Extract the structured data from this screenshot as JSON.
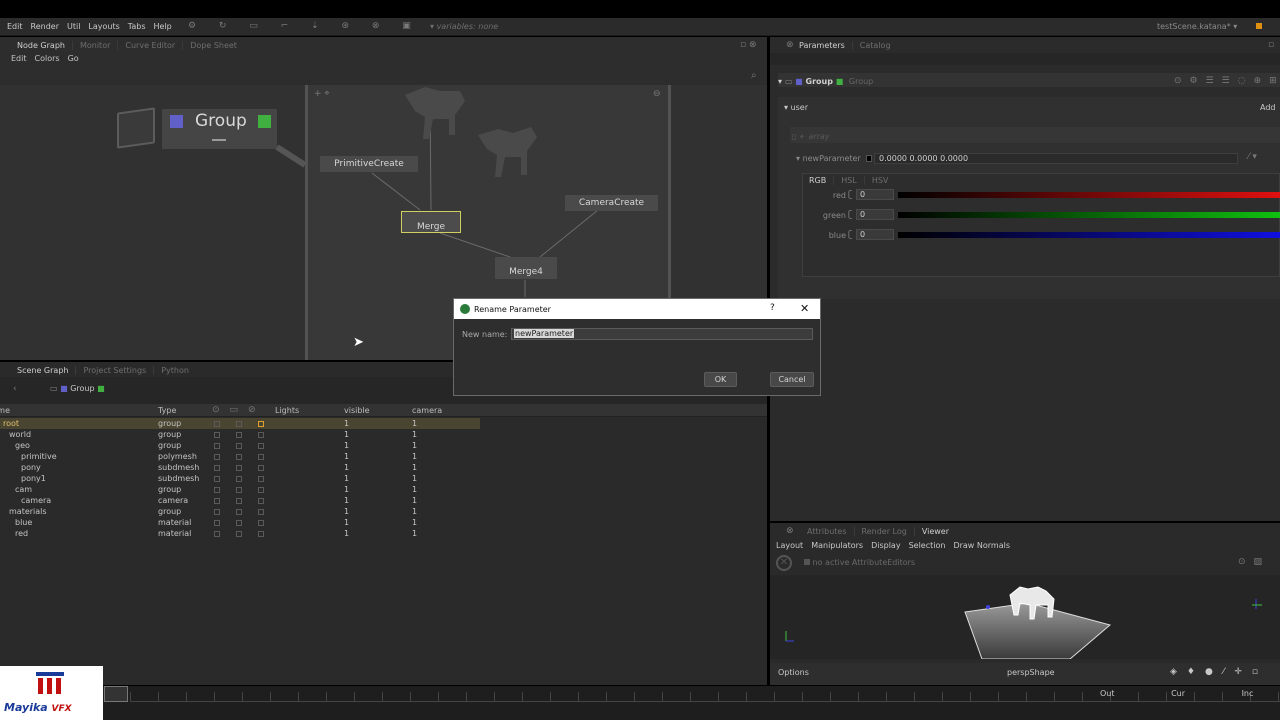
{
  "menubar": {
    "items": [
      "Edit",
      "Render",
      "Util",
      "Layouts",
      "Tabs",
      "Help"
    ],
    "variables": "variables: none",
    "scene": "testScene.katana*"
  },
  "nodegraph": {
    "tabs": [
      "Node Graph",
      "Monitor",
      "Curve Editor",
      "Dope Sheet"
    ],
    "menu": [
      "Edit",
      "Colors",
      "Go"
    ],
    "group_label": "Group",
    "nodes": {
      "primitive": "PrimitiveCreate",
      "merge": "Merge",
      "camera": "CameraCreate",
      "merge4": "Merge4"
    }
  },
  "params": {
    "tabs": [
      "Parameters",
      "Catalog"
    ],
    "node_name": "Group",
    "node_type": "Group",
    "section": "user",
    "add": "Add",
    "array_label": "array",
    "param_name": "newParameter",
    "values": "0.0000  0.0000  0.0000",
    "color_tabs": [
      "RGB",
      "HSL",
      "HSV"
    ],
    "channels": [
      {
        "name": "red",
        "value": "0",
        "color": "#e01010"
      },
      {
        "name": "green",
        "value": "0",
        "color": "#10c010"
      },
      {
        "name": "blue",
        "value": "0",
        "color": "#1010e0"
      }
    ]
  },
  "scenegraph": {
    "tabs": [
      "Scene Graph",
      "Project Settings",
      "Python"
    ],
    "location": "Group",
    "headers": [
      "Name",
      "Type",
      "Lights",
      "visible",
      "camera"
    ],
    "rows": [
      {
        "name": "root",
        "type": "group",
        "visible": "1",
        "camera": "1",
        "indent": 0
      },
      {
        "name": "world",
        "type": "group",
        "visible": "1",
        "camera": "1",
        "indent": 1
      },
      {
        "name": "geo",
        "type": "group",
        "visible": "1",
        "camera": "1",
        "indent": 2
      },
      {
        "name": "primitive",
        "type": "polymesh",
        "visible": "1",
        "camera": "1",
        "indent": 3
      },
      {
        "name": "pony",
        "type": "subdmesh",
        "visible": "1",
        "camera": "1",
        "indent": 3
      },
      {
        "name": "pony1",
        "type": "subdmesh",
        "visible": "1",
        "camera": "1",
        "indent": 3
      },
      {
        "name": "cam",
        "type": "group",
        "visible": "1",
        "camera": "1",
        "indent": 2
      },
      {
        "name": "camera",
        "type": "camera",
        "visible": "1",
        "camera": "1",
        "indent": 3
      },
      {
        "name": "materials",
        "type": "group",
        "visible": "1",
        "camera": "1",
        "indent": 1
      },
      {
        "name": "blue",
        "type": "material",
        "visible": "1",
        "camera": "1",
        "indent": 2
      },
      {
        "name": "red",
        "type": "material",
        "visible": "1",
        "camera": "1",
        "indent": 2
      }
    ]
  },
  "dialog": {
    "title": "Rename Parameter",
    "help": "?",
    "label": "New name:",
    "value": "newParameter",
    "ok": "OK",
    "cancel": "Cancel"
  },
  "viewer": {
    "tabs": [
      "Attributes",
      "Render Log",
      "Viewer"
    ],
    "menu": [
      "Layout",
      "Manipulators",
      "Display",
      "Selection",
      "Draw Normals"
    ],
    "no_editors": "no active AttributeEditors",
    "options": "Options",
    "camera": "perspShape"
  },
  "timeline": {
    "labels": [
      "Out",
      "Cur",
      "Inc"
    ]
  },
  "logo": {
    "text": "Mayika VFX"
  }
}
